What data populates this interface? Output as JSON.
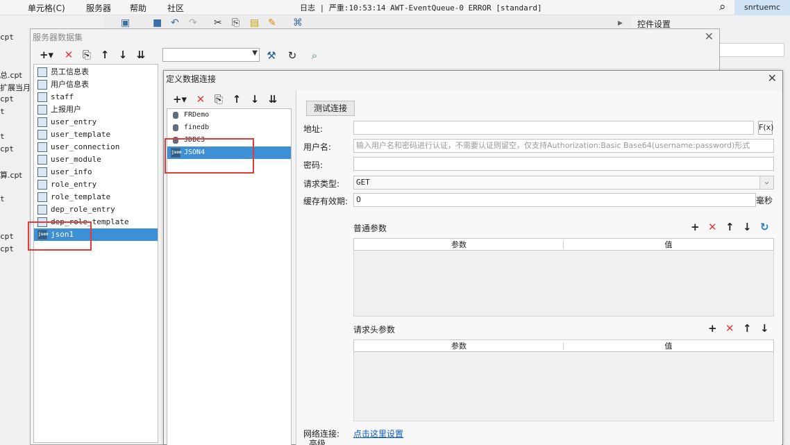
{
  "menubar": {
    "items": [
      "单元格(C)",
      "服务器",
      "帮助",
      "社区"
    ],
    "log_text": "日志 | 严重:10:53:14 AWT-EventQueue-0 ERROR [standard]",
    "user": "snrtuemc"
  },
  "right_panel": {
    "title": "控件设置"
  },
  "bg_files": [
    "cpt",
    "总.cpt",
    "扩展当月",
    "cpt",
    "t",
    "t",
    "cpt",
    "算.cpt",
    "t",
    "cpt",
    "cpt"
  ],
  "ds_dialog": {
    "title": "服务器数据集",
    "items": [
      "员工信息表",
      "用户信息表",
      "staff",
      "上报用户",
      "user_entry",
      "user_template",
      "user_connection",
      "user_module",
      "user_info",
      "role_entry",
      "role_template",
      "dep_role_entry",
      "dep_role_template",
      "json1"
    ],
    "json_icon_text": "json"
  },
  "conn_dialog": {
    "title": "定义数据连接",
    "items": [
      "FRDemo",
      "finedb",
      "JDBC3",
      "JSON4"
    ],
    "json_icon_text": "json",
    "test_button": "测试连接",
    "labels": {
      "address": "地址:",
      "username": "用户名:",
      "password": "密码:",
      "request_type": "请求类型:",
      "cache": "缓存有效期:"
    },
    "username_placeholder": "输入用户名和密码进行认证，不需要认证则留空，仅支持Authorization:Basic Base64(username:password)形式",
    "request_type_value": "GET",
    "cache_value": "0",
    "cache_unit": "毫秒",
    "fx_label": "F(x)",
    "normal_params": {
      "title": "普通参数",
      "col_param": "参数",
      "col_value": "值"
    },
    "header_params": {
      "title": "请求头参数",
      "col_param": "参数",
      "col_value": "值"
    },
    "network_label": "网络连接:",
    "network_link": "点击这里设置",
    "advanced_label": "高级"
  },
  "colors": {
    "selection": "#3d8fd6",
    "delete": "#e53935",
    "link": "#0a58c7",
    "annotation": "#e53935"
  },
  "icons": [
    "add-icon",
    "delete-icon",
    "copy-icon",
    "move-up-icon",
    "move-down-icon",
    "sort-icon",
    "refresh-icon",
    "preview-icon",
    "edit-icon",
    "search-icon",
    "close-icon",
    "chevron-down-icon"
  ]
}
